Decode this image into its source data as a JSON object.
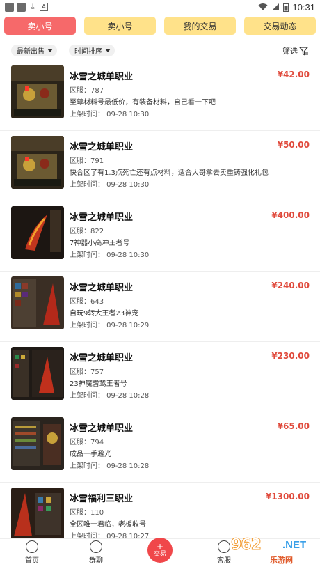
{
  "status_bar": {
    "time": "10:31"
  },
  "tabs": [
    {
      "label": "卖小号",
      "active": true
    },
    {
      "label": "卖小号",
      "active": false
    },
    {
      "label": "我的交易",
      "active": false
    },
    {
      "label": "交易动态",
      "active": false
    }
  ],
  "filters": {
    "sort_latest": "最新出售",
    "sort_time": "时间排序",
    "screen": "筛选"
  },
  "listings": [
    {
      "title": "冰雪之城单职业",
      "price": "¥42.00",
      "server": "区服：787",
      "desc": "至尊材料号最低价，有装备材料，自己看一下吧",
      "time": "上架时间：  09-28 10:30"
    },
    {
      "title": "冰雪之城单职业",
      "price": "¥50.00",
      "server": "区服：791",
      "desc": "快合区了有1.3点死亡还有点材料，适合大哥拿去卖重铸强化礼包",
      "time": "上架时间：  09-28 10:30"
    },
    {
      "title": "冰雪之城单职业",
      "price": "¥400.00",
      "server": "区服：822",
      "desc": "7神器小高冲王者号",
      "time": "上架时间：  09-28 10:30"
    },
    {
      "title": "冰雪之城单职业",
      "price": "¥240.00",
      "server": "区服：643",
      "desc": "自玩9转大王者23神宠",
      "time": "上架时间：  09-28 10:29"
    },
    {
      "title": "冰雪之城单职业",
      "price": "¥230.00",
      "server": "区服：757",
      "desc": "23神魔耆鸷王者号",
      "time": "上架时间：  09-28 10:28"
    },
    {
      "title": "冰雪之城单职业",
      "price": "¥65.00",
      "server": "区服：794",
      "desc": "成品一手避光",
      "time": "上架时间：  09-28 10:28"
    },
    {
      "title": "冰雪福利三职业",
      "price": "¥1300.00",
      "server": "区服：110",
      "desc": "全区唯一君临，老板收号",
      "time": "上架时间：  09-28 10:27"
    }
  ],
  "bottom_nav": {
    "home": "首页",
    "chat": "群聊",
    "trade": "交易",
    "service": "客服"
  },
  "watermark": {
    "number": "962",
    "net": ".NET",
    "site": "乐游网"
  },
  "colors": {
    "active_tab": "#f6696a",
    "tab": "#ffe28a",
    "price": "#e04a3c",
    "trade_button": "#f0474a"
  }
}
